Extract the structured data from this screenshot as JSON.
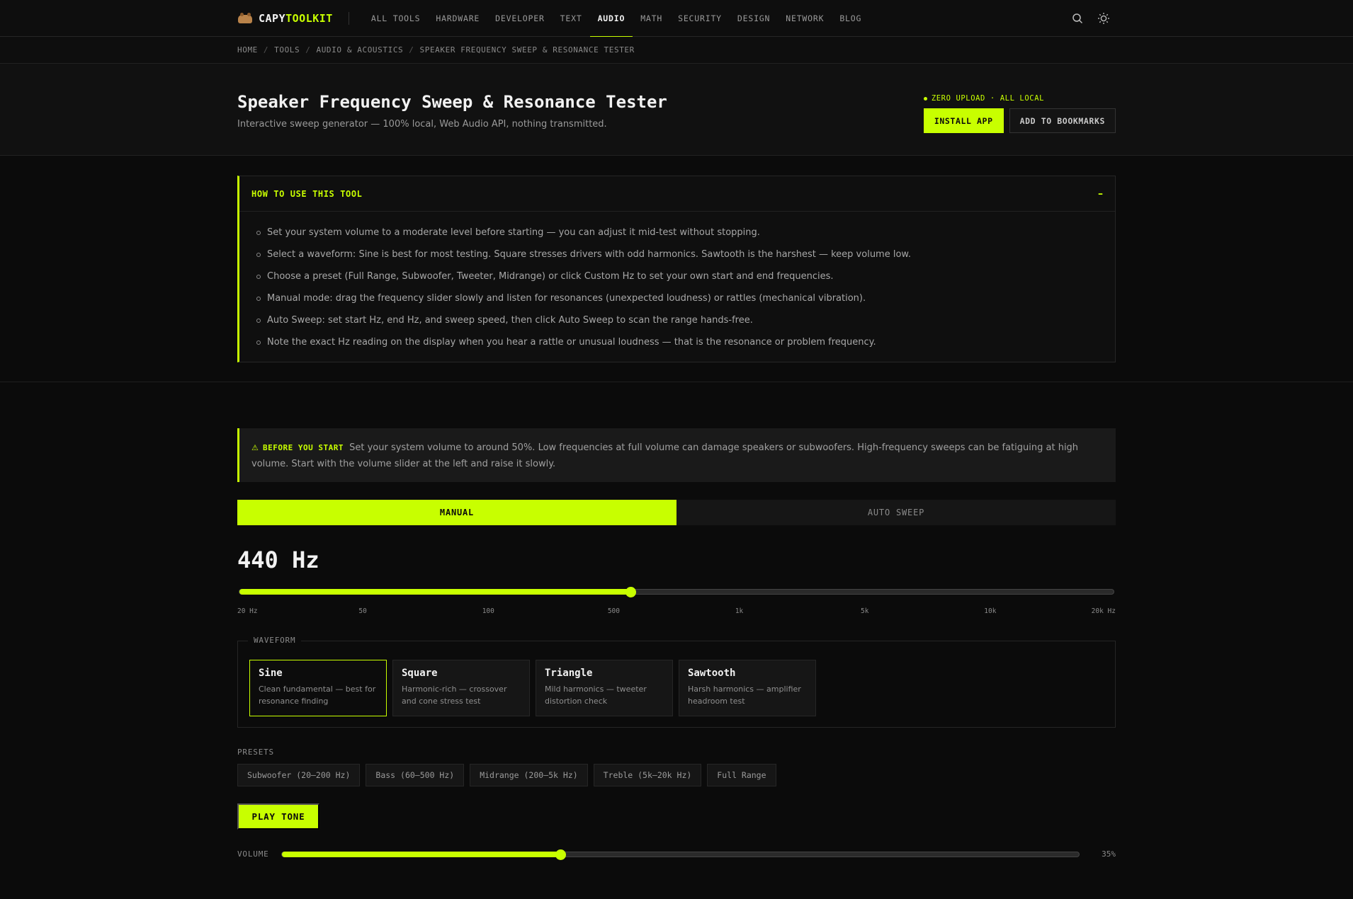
{
  "brand": {
    "part1": "CAPY",
    "part2": "TOOLKIT",
    "logo_icon": "capybara-icon"
  },
  "nav": {
    "links": [
      "ALL TOOLS",
      "HARDWARE",
      "DEVELOPER",
      "TEXT",
      "AUDIO",
      "MATH",
      "SECURITY",
      "DESIGN",
      "NETWORK",
      "BLOG"
    ],
    "active": "AUDIO",
    "icons": [
      "search-icon",
      "sun-icon"
    ]
  },
  "breadcrumb": {
    "items": [
      "HOME",
      "TOOLS",
      "AUDIO & ACOUSTICS",
      "SPEAKER FREQUENCY SWEEP & RESONANCE TESTER"
    ],
    "separator": "/"
  },
  "header": {
    "title": "Speaker Frequency Sweep & Resonance Tester",
    "subtitle": "Interactive sweep generator — 100% local, Web Audio API, nothing transmitted.",
    "badge": "ZERO UPLOAD · ALL LOCAL",
    "install_label": "INSTALL APP",
    "bookmark_label": "ADD TO BOOKMARKS"
  },
  "howto": {
    "title": "HOW TO USE THIS TOOL",
    "toggle": "–",
    "items": [
      "Set your system volume to a moderate level before starting — you can adjust it mid-test without stopping.",
      "Select a waveform: Sine is best for most testing. Square stresses drivers with odd harmonics. Sawtooth is the harshest — keep volume low.",
      "Choose a preset (Full Range, Subwoofer, Tweeter, Midrange) or click Custom Hz to set your own start and end frequencies.",
      "Manual mode: drag the frequency slider slowly and listen for resonances (unexpected loudness) or rattles (mechanical vibration).",
      "Auto Sweep: set start Hz, end Hz, and sweep speed, then click Auto Sweep to scan the range hands-free.",
      "Note the exact Hz reading on the display when you hear a rattle or unusual loudness — that is the resonance or problem frequency."
    ]
  },
  "warning": {
    "icon": "warning-triangle-icon",
    "label": "BEFORE YOU START",
    "text": "Set your system volume to around 50%. Low frequencies at full volume can damage speakers or subwoofers. High-frequency sweeps can be fatiguing at high volume. Start with the volume slider at the left and raise it slowly."
  },
  "modes": {
    "tabs": [
      "MANUAL",
      "AUTO SWEEP"
    ],
    "active": "MANUAL"
  },
  "frequency": {
    "display": "440 Hz",
    "value_hz": 440,
    "min_hz": 20,
    "max_hz": 20000,
    "scale": "log",
    "tick_labels": [
      "20 Hz",
      "50",
      "100",
      "500",
      "1k",
      "5k",
      "10k",
      "20k Hz"
    ],
    "tick_values": [
      20,
      50,
      100,
      500,
      1000,
      5000,
      10000,
      20000
    ]
  },
  "waveform": {
    "legend": "WAVEFORM",
    "selected": "Sine",
    "options": [
      {
        "name": "Sine",
        "desc": "Clean fundamental — best for resonance finding"
      },
      {
        "name": "Square",
        "desc": "Harmonic-rich — crossover and cone stress test"
      },
      {
        "name": "Triangle",
        "desc": "Mild harmonics — tweeter distortion check"
      },
      {
        "name": "Sawtooth",
        "desc": "Harsh harmonics — amplifier headroom test"
      }
    ]
  },
  "presets": {
    "label": "PRESETS",
    "items": [
      "Subwoofer (20–200 Hz)",
      "Bass (60–500 Hz)",
      "Midrange (200–5k Hz)",
      "Treble (5k–20k Hz)",
      "Full Range"
    ]
  },
  "play_label": "PLAY TONE",
  "volume": {
    "label": "VOLUME",
    "value_text": "35%",
    "value": 0.35
  },
  "colors": {
    "accent": "#c8ff00",
    "background": "#0b0b0b",
    "surface": "#161616"
  }
}
